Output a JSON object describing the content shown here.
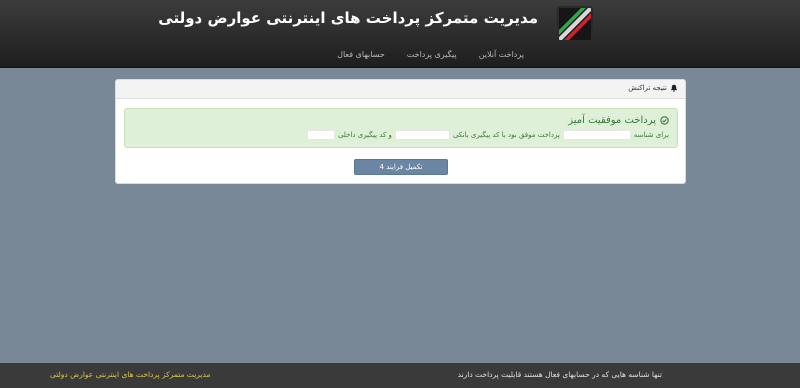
{
  "header": {
    "logo": "logo-icon",
    "title": "مدیریت متمرکز پرداخت های اینترنتی عوارض دولتی",
    "nav": [
      {
        "label": "پرداخت آنلاین"
      },
      {
        "label": "پیگیری پرداخت"
      },
      {
        "label": "حسابهای فعال"
      }
    ]
  },
  "panel": {
    "heading": "نتیجه تراکنش",
    "heading_icon": "bell-icon",
    "alert": {
      "title": "پرداخت موفقیت آمیز",
      "icon": "check-circle-icon",
      "text_1": "برای شناسه",
      "text_2": "پرداخت موفق بود با کد پیگیری بانکی",
      "text_3": "و کد پیگیری داخلی"
    },
    "button_label": "تکمیل فرایند 4"
  },
  "footer": {
    "note": "تنها شناسه هایی که در حسابهای فعال هستند قابلیت پرداخت دارند",
    "brand": "مدیریت متمرکز پرداخت های اینترنتی عوارض دولتی"
  },
  "colors": {
    "background": "#788896",
    "header": "#2a2a2a",
    "alert_bg": "#dff0d8",
    "alert_text": "#3c763d",
    "button": "#6a86a3",
    "footer_brand": "#d9c84a"
  }
}
